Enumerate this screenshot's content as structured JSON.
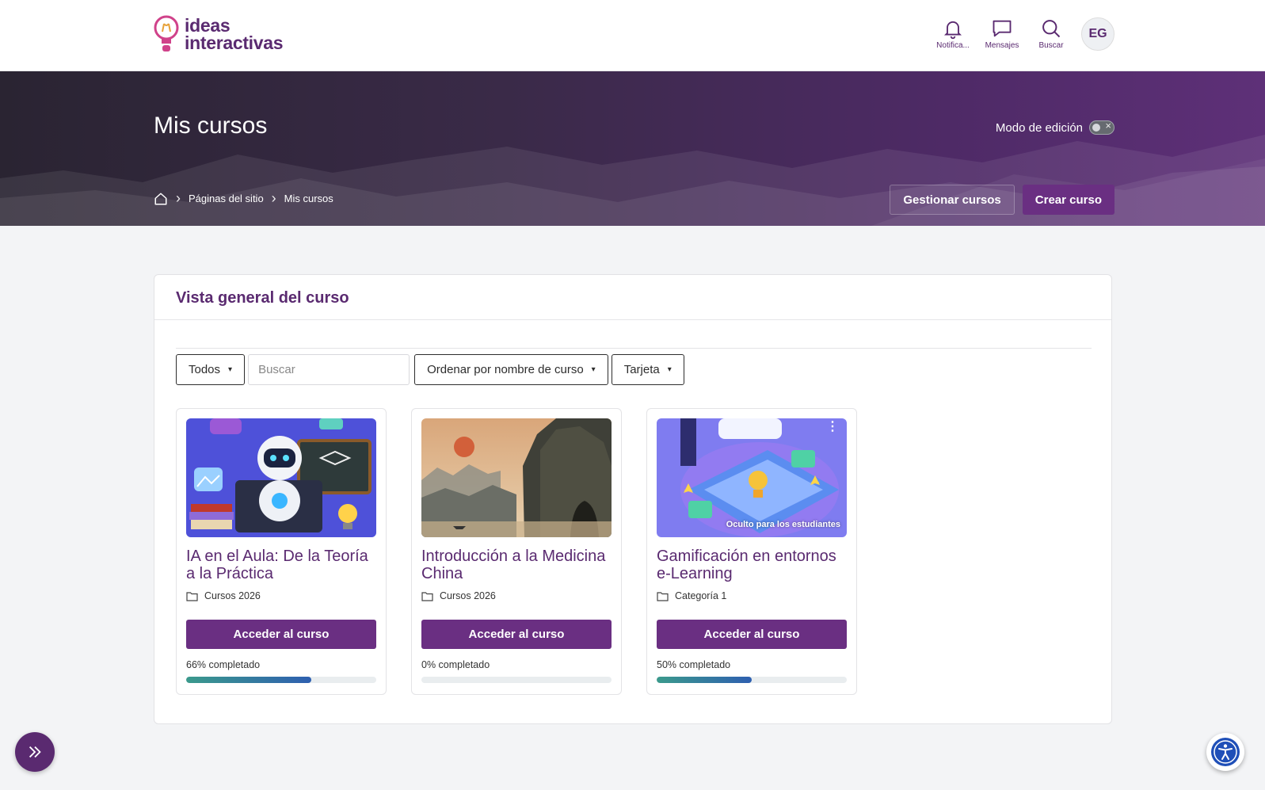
{
  "app": {
    "logo_line1": "ideas",
    "logo_line2": "interactivas",
    "brand_color": "#6a2f82"
  },
  "topnav": {
    "notifications_label": "Notifica...",
    "messages_label": "Mensajes",
    "search_label": "Buscar",
    "avatar_initials": "EG"
  },
  "hero": {
    "title": "Mis cursos",
    "edit_mode_label": "Modo de edición",
    "breadcrumb": [
      "Páginas del sitio",
      "Mis cursos"
    ],
    "manage_label": "Gestionar cursos",
    "create_label": "Crear curso"
  },
  "overview": {
    "title": "Vista general del curso",
    "filter_selected": "Todos",
    "search_placeholder": "Buscar",
    "sort_selected": "Ordenar por nombre de curso",
    "view_selected": "Tarjeta",
    "courses": [
      {
        "title": "IA en el Aula: De la Teoría a la Práctica",
        "category": "Cursos 2026",
        "button": "Acceder al curso",
        "progress_text": "66% completado",
        "progress": 66,
        "image": "robot-classroom"
      },
      {
        "title": "Introducción a la Medicina China",
        "category": "Cursos 2026",
        "button": "Acceder al curso",
        "progress_text": "0% completado",
        "progress": 0,
        "image": "chinese-landscape"
      },
      {
        "title": "Gamificación en entornos e-Learning",
        "category": "Categoría 1",
        "button": "Acceder al curso",
        "progress_text": "50% completado",
        "progress": 50,
        "image": "isometric-game",
        "badge": "Oculto para los estudiantes"
      }
    ]
  }
}
